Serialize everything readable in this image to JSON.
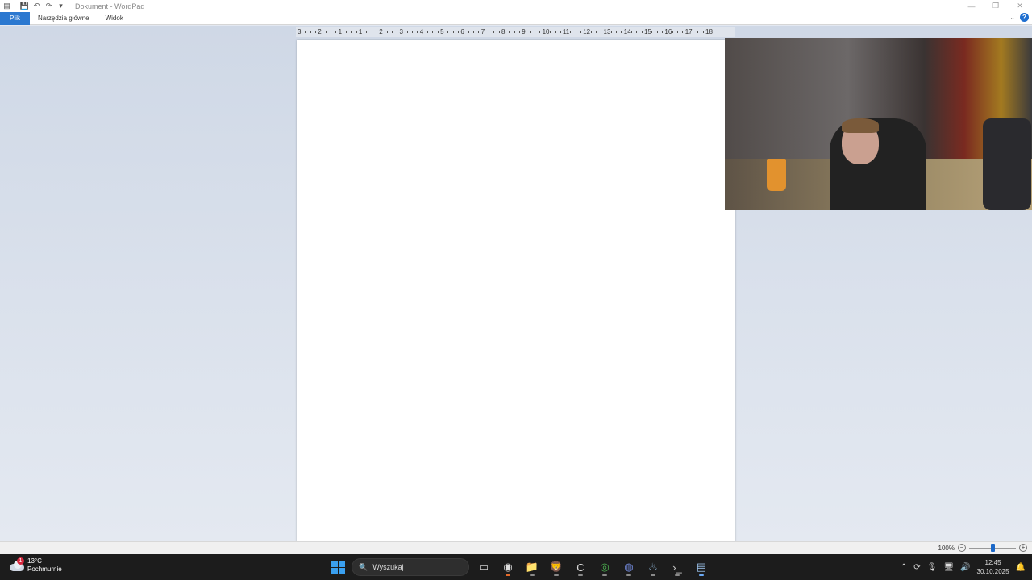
{
  "window": {
    "title": "Dokument - WordPad"
  },
  "ribbon": {
    "tabs": [
      "Plik",
      "Narzędzia główne",
      "Widok"
    ]
  },
  "ruler": {
    "labels": [
      "3",
      "2",
      "1",
      "1",
      "2",
      "3",
      "4",
      "5",
      "6",
      "7",
      "8",
      "9",
      "10",
      "11",
      "12",
      "13",
      "14",
      "15",
      "16",
      "17",
      "18"
    ]
  },
  "statusbar": {
    "zoom_label": "100%",
    "zoom_fraction": 0.5
  },
  "taskbar": {
    "weather_temp": "13°C",
    "weather_desc": "Pochmurnie",
    "weather_badge": "1",
    "search_placeholder": "Wyszukaj",
    "time": "12:45",
    "date": "30.10.2025"
  },
  "colors": {
    "file_tab": "#2b78d0",
    "accent": "#1c68c7",
    "taskbar": "#1c1c1c"
  }
}
